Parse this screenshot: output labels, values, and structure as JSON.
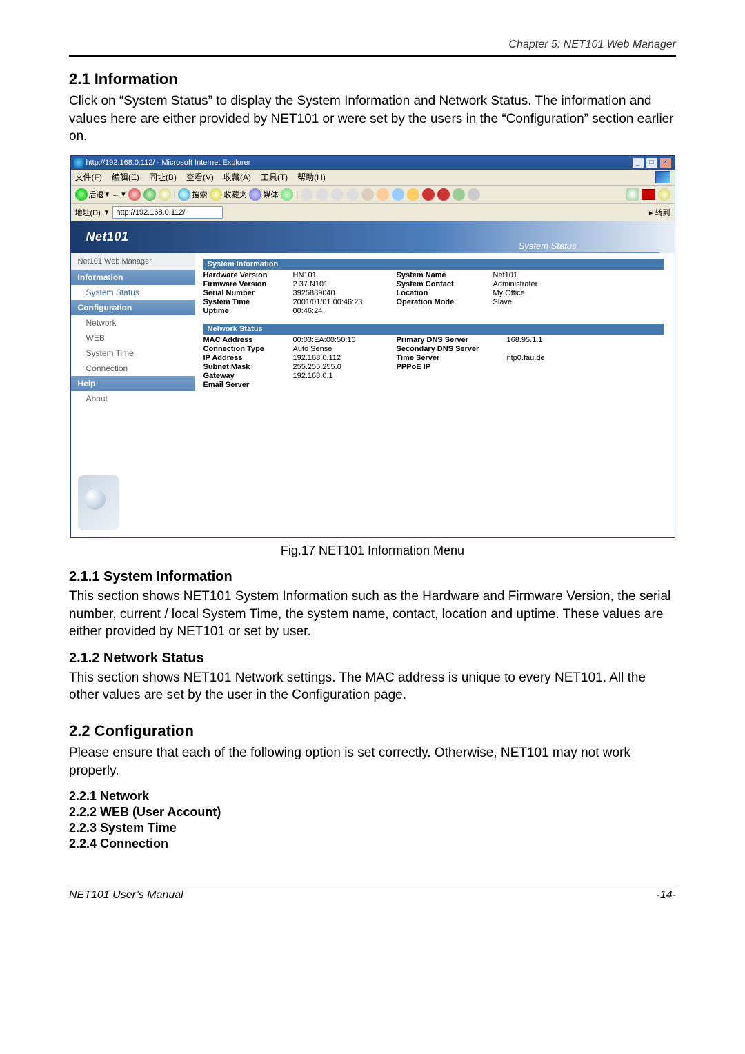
{
  "header": {
    "chapter": "Chapter 5: NET101 Web Manager"
  },
  "s21": {
    "title": "2.1 Information",
    "para": "Click on “System Status” to display the System Information and Network Status. The information and values here are either provided by NET101 or were set by the users in the “Configuration” section earlier on."
  },
  "figcap": "Fig.17  NET101 Information Menu",
  "s211": {
    "title": "2.1.1    System Information",
    "para": "This section shows NET101 System Information such as the Hardware and Firmware Version, the serial number, current / local System Time, the system name, contact, location and uptime. These values are either provided by NET101 or set by user."
  },
  "s212": {
    "title": "2.1.2    Network Status",
    "para": "This section shows NET101 Network settings. The MAC address is unique to every NET101. All the other values are set by the user in the Configuration page."
  },
  "s22": {
    "title": "2.2 Configuration",
    "para": "Please ensure that each of the following option is set correctly. Otherwise, NET101 may not work properly.",
    "items": [
      "2.2.1 Network",
      "2.2.2 WEB (User Account)",
      "2.2.3 System Time",
      "2.2.4 Connection"
    ]
  },
  "footer": {
    "manual": "NET101  User’s  Manual",
    "page": "-14-"
  },
  "ie": {
    "title": "http://192.168.0.112/ - Microsoft Internet Explorer",
    "menu": [
      "文件(F)",
      "编辑(E)",
      "同址(B)",
      "查看(V)",
      "收藏(A)",
      "工具(T)",
      "帮助(H)"
    ],
    "toolbar": {
      "back": "后退",
      "search": "搜索",
      "fav": "收藏夹",
      "media": "媒体"
    },
    "addr_label": "地址(D)",
    "addr_value": "http://192.168.0.112/",
    "go": "转到"
  },
  "net": {
    "brand": "Net101",
    "status_label": "System Status",
    "side": {
      "mgr": "Net101 Web Manager",
      "sec_info": "Information",
      "link_sys": "System Status",
      "sec_cfg": "Configuration",
      "link_net": "Network",
      "link_web": "WEB",
      "link_time": "System Time",
      "link_conn": "Connection",
      "sec_help": "Help",
      "link_about": "About"
    },
    "panel1_title": "System Information",
    "sys": {
      "hw_l": "Hardware Version",
      "hw_v": "HN101",
      "fw_l": "Firmware Version",
      "fw_v": "2.37.N101",
      "sn_l": "Serial Number",
      "sn_v": "3925889040",
      "st_l": "System Time",
      "st_v": "2001/01/01 00:46:23",
      "up_l": "Uptime",
      "up_v": "00:46:24",
      "name_l": "System Name",
      "name_v": "Net101",
      "contact_l": "System Contact",
      "contact_v": "Administrater",
      "loc_l": "Location",
      "loc_v": "My Office",
      "op_l": "Operation Mode",
      "op_v": "Slave"
    },
    "panel2_title": "Network Status",
    "netw": {
      "mac_l": "MAC Address",
      "mac_v": "00:03:EA:00:50:10",
      "ct_l": "Connection Type",
      "ct_v": "Auto Sense",
      "ip_l": "IP Address",
      "ip_v": "192.168.0.112",
      "sm_l": "Subnet Mask",
      "sm_v": "255.255.255.0",
      "gw_l": "Gateway",
      "gw_v": "192.168.0.1",
      "em_l": "Email Server",
      "em_v": "",
      "pdns_l": "Primary DNS Server",
      "pdns_v": "168.95.1.1",
      "sdns_l": "Secondary DNS Server",
      "sdns_v": "",
      "ts_l": "Time Server",
      "ts_v": "ntp0.fau.de",
      "ppp_l": "PPPoE IP",
      "ppp_v": ""
    }
  }
}
